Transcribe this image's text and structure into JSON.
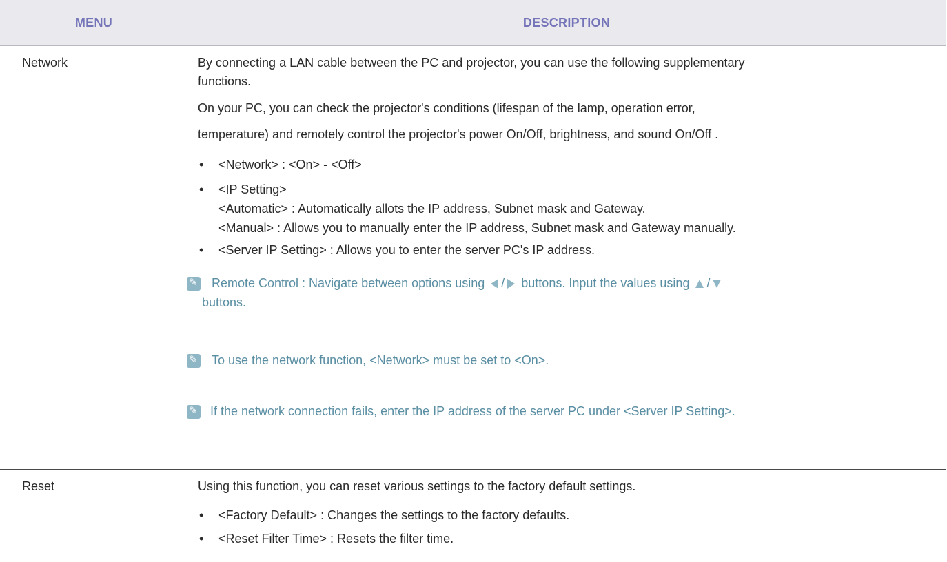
{
  "header": {
    "menu": "MENU",
    "description": "DESCRIPTION"
  },
  "network": {
    "menu": "Network",
    "intro1": "By connecting a LAN cable between the PC and projector, you can use the following supplementary",
    "intro2": "functions.",
    "para1": "On your PC, you can check the projector's conditions (lifespan of the lamp, operation error,",
    "para2": "temperature) and remotely control the projector's power On/Off, brightness, and sound On/Off .",
    "bullet_network": "<Network> : <On> - <Off>",
    "bullet_ip": "<IP Setting>",
    "ip_auto": "<Automatic> : Automatically allots the IP address, Subnet mask and Gateway.",
    "ip_manual": "<Manual> : Allows you to manually enter the IP address, Subnet mask and Gateway manually.",
    "bullet_server": "<Server IP Setting> : Allows you to enter the server PC's IP address.",
    "note1_a": "Remote Control : Navigate between options using",
    "note1_slash": "/",
    "note1_b": "buttons. Input the values using",
    "note1_slash2": "/",
    "note1_c": "buttons.",
    "note2": "To use the network function, <Network> must be set to <On>.",
    "note3": "If the network connection fails, enter the IP address of the server PC under <Server IP Setting>."
  },
  "reset": {
    "menu": "Reset",
    "intro": "Using this function, you can reset various settings to the factory default settings.",
    "bullet_factory": "<Factory Default> : Changes the settings to the factory defaults.",
    "bullet_filter": "<Reset Filter Time> : Resets the filter time."
  },
  "bullet_char": "•",
  "colors": {
    "header_text": "#7474b8",
    "note_text": "#5a8ea3",
    "note_icon": "#8fb6c4",
    "header_bg": "#e9e9ee"
  },
  "icons": {
    "note": "note-pencil-icon",
    "left": "left-triangle-icon",
    "right": "right-triangle-icon",
    "up": "up-triangle-icon",
    "down": "down-triangle-icon"
  }
}
